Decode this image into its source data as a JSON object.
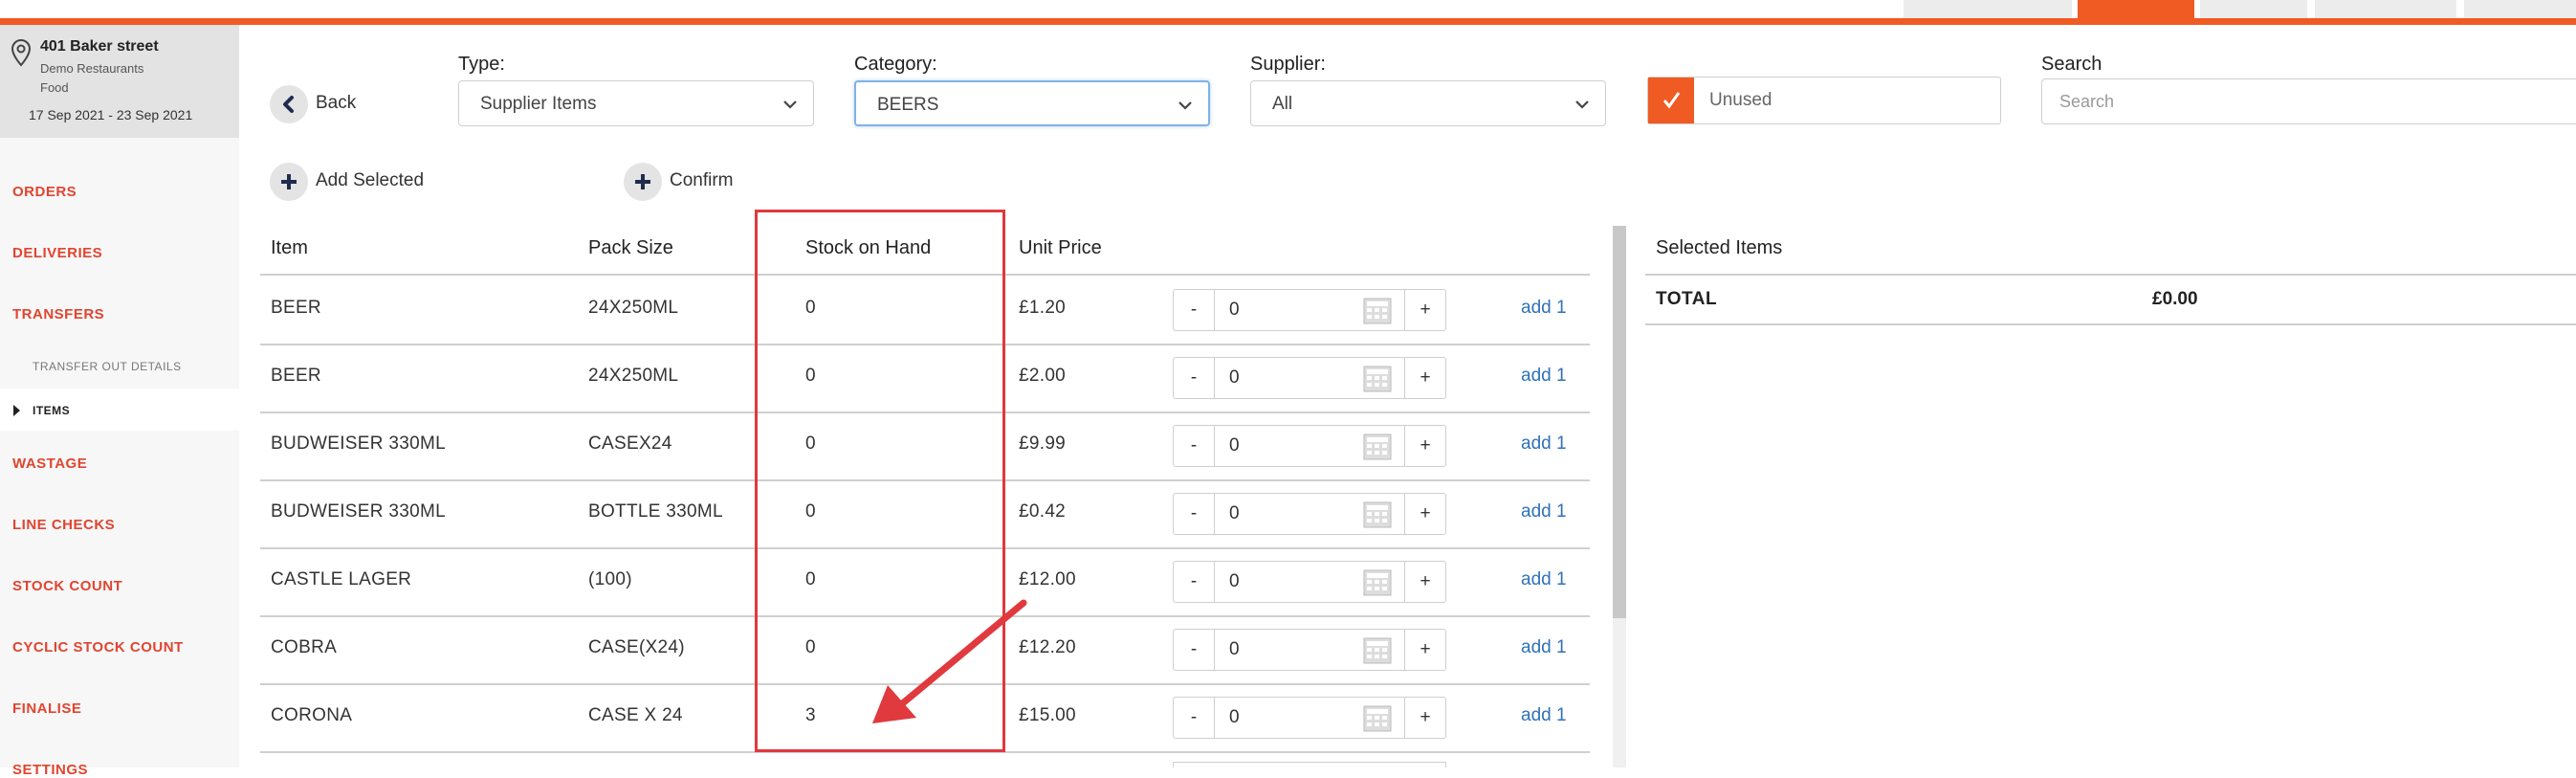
{
  "sidebar": {
    "location_name": "401 Baker street",
    "location_sub1": "Demo Restaurants",
    "location_sub2": "Food",
    "date_range": "17 Sep 2021 - 23 Sep 2021",
    "nav": {
      "orders": "ORDERS",
      "deliveries": "DELIVERIES",
      "transfers": "TRANSFERS",
      "transfer_out_details": "TRANSFER OUT DETAILS",
      "items": "ITEMS",
      "wastage": "WASTAGE",
      "line_checks": "LINE CHECKS",
      "stock_count": "STOCK COUNT",
      "cyclic_stock_count": "CYCLIC STOCK COUNT",
      "finalise": "FINALISE",
      "settings": "SETTINGS"
    }
  },
  "toolbar": {
    "back_label": "Back",
    "add_selected_label": "Add Selected",
    "confirm_label": "Confirm"
  },
  "filters": {
    "type_label": "Type:",
    "type_value": "Supplier Items",
    "category_label": "Category:",
    "category_value": "BEERS",
    "supplier_label": "Supplier:",
    "supplier_value": "All",
    "unused_label": "Unused",
    "unused_checked": true,
    "search_label": "Search",
    "search_placeholder": "Search"
  },
  "table": {
    "headers": {
      "item": "Item",
      "pack_size": "Pack Size",
      "stock_on_hand": "Stock on Hand",
      "unit_price": "Unit Price"
    },
    "rows": [
      {
        "item": "BEER",
        "pack": "24X250ML",
        "stock": "0",
        "price": "£1.20",
        "qty": "0",
        "minus": "-",
        "plus": "+",
        "add": "add 1"
      },
      {
        "item": "BEER",
        "pack": "24X250ML",
        "stock": "0",
        "price": "£2.00",
        "qty": "0",
        "minus": "-",
        "plus": "+",
        "add": "add 1"
      },
      {
        "item": "BUDWEISER 330ML",
        "pack": "CASEX24",
        "stock": "0",
        "price": "£9.99",
        "qty": "0",
        "minus": "-",
        "plus": "+",
        "add": "add 1"
      },
      {
        "item": "BUDWEISER 330ML",
        "pack": "BOTTLE 330ML",
        "stock": "0",
        "price": "£0.42",
        "qty": "0",
        "minus": "-",
        "plus": "+",
        "add": "add 1"
      },
      {
        "item": "CASTLE LAGER",
        "pack": "(100)",
        "stock": "0",
        "price": "£12.00",
        "qty": "0",
        "minus": "-",
        "plus": "+",
        "add": "add 1"
      },
      {
        "item": "COBRA",
        "pack": "CASE(X24)",
        "stock": "0",
        "price": "£12.20",
        "qty": "0",
        "minus": "-",
        "plus": "+",
        "add": "add 1"
      },
      {
        "item": "CORONA",
        "pack": "CASE X 24",
        "stock": "3",
        "price": "£15.00",
        "qty": "0",
        "minus": "-",
        "plus": "+",
        "add": "add 1"
      }
    ]
  },
  "selected_panel": {
    "title": "Selected Items",
    "total_label": "TOTAL",
    "total_value": "£0.00"
  },
  "colors": {
    "accent": "#f05a23",
    "nav_red": "#e04530",
    "link_blue": "#2f72b8",
    "annotation_red": "#e0393e"
  }
}
